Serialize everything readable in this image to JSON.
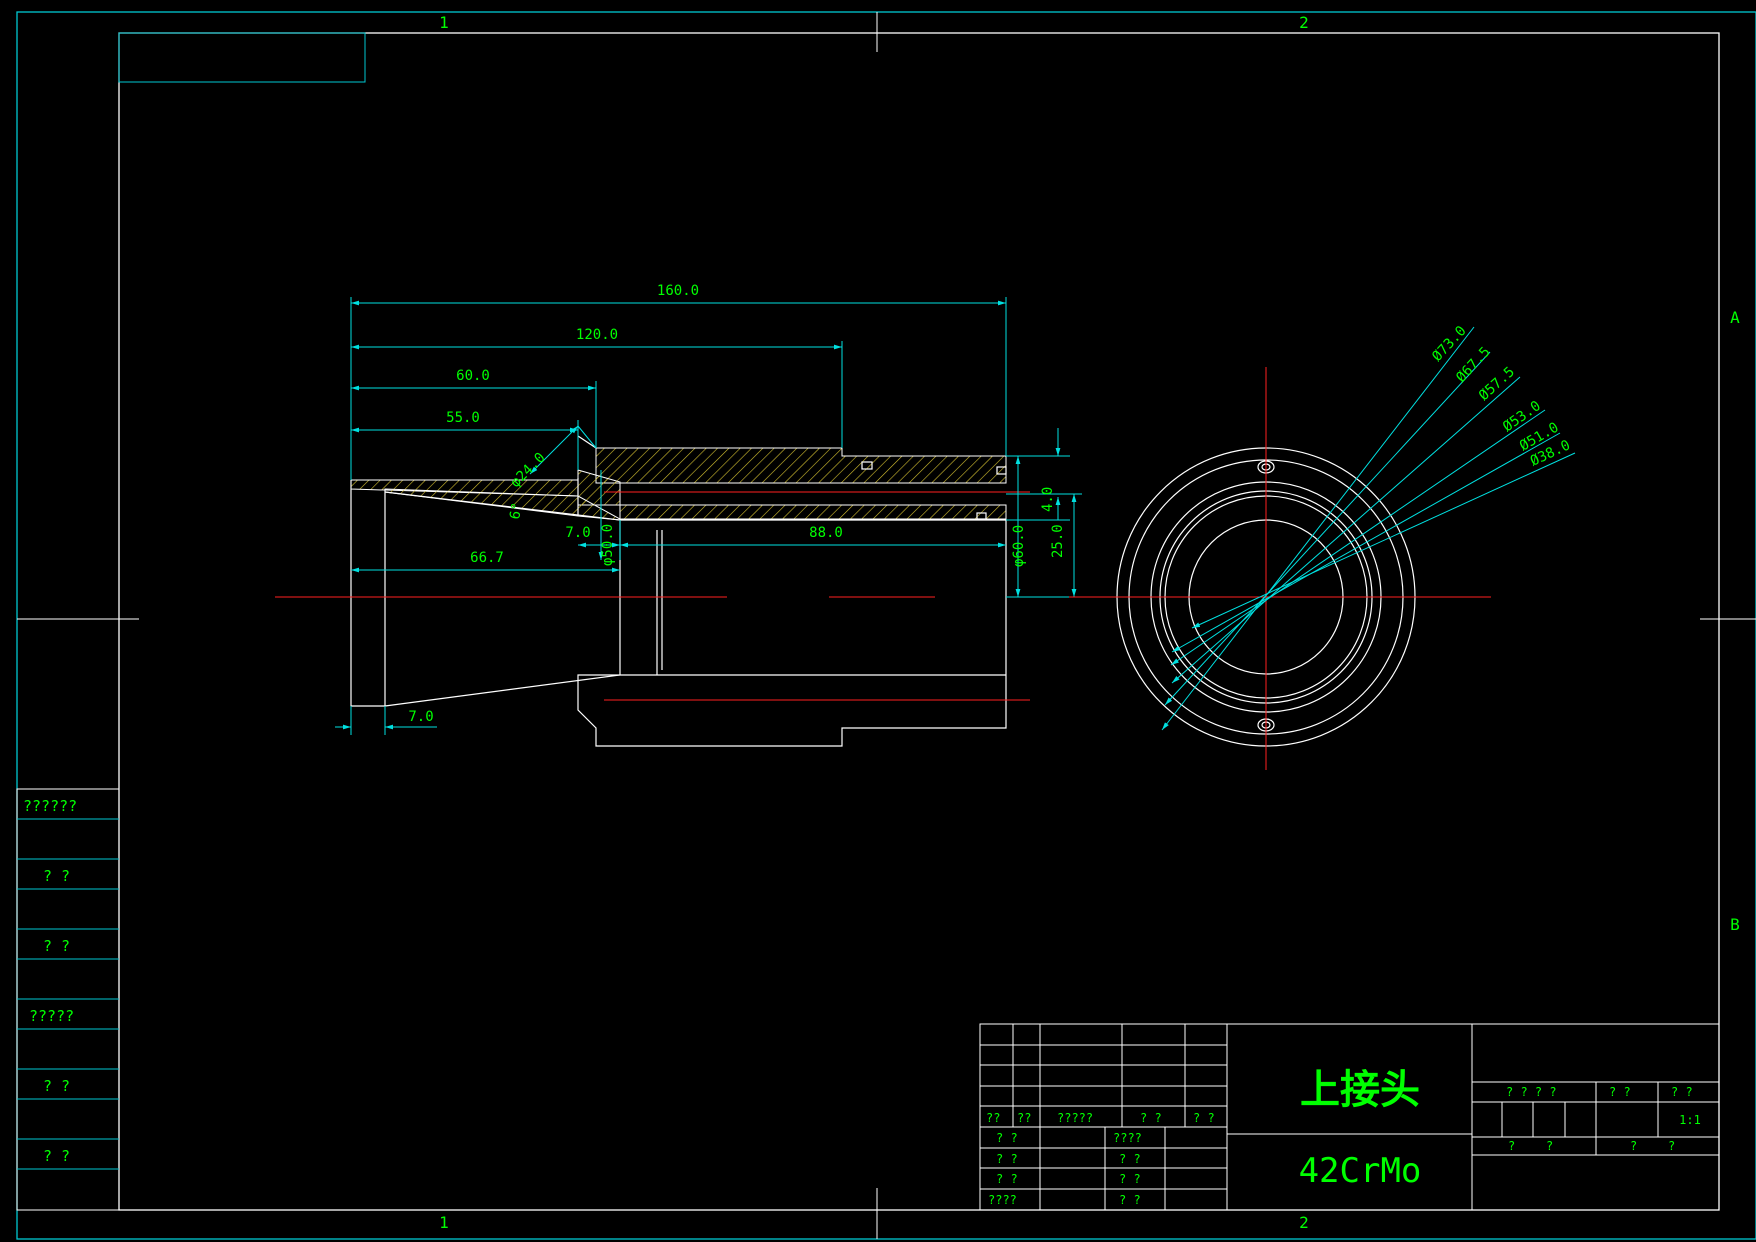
{
  "colors": {
    "background": "#000000",
    "frame": "#00c8d2",
    "outline": "#ffffff",
    "dimension": "#00e0e0",
    "text": "#00ff00",
    "centerline": "#ff2020",
    "hatch": "#d4c030"
  },
  "grid": {
    "col_top_left": "1",
    "col_top_right": "2",
    "col_bottom_left": "1",
    "col_bottom_right": "2",
    "row_a": "A",
    "row_b": "B"
  },
  "section_view": {
    "dims": {
      "total_length": "160.0",
      "length_120": "120.0",
      "length_60": "60.0",
      "length_55": "55.0",
      "chamfer_dia": "φ24.0",
      "angle": "6°",
      "step_7": "7.0",
      "bore_length": "88.0",
      "taper_length": "66.7",
      "bore_dia": "φ50.0",
      "outer_dia_60": "φ60.0",
      "offset_4": "4.0",
      "height_25": "25.0",
      "lip_7": "7.0"
    }
  },
  "end_view": {
    "dims": [
      "Ø73.0",
      "Ø67.5",
      "Ø57.5",
      "Ø53.0",
      "Ø51.0",
      "Ø38.0"
    ]
  },
  "side_table": [
    "??????",
    "?  ?",
    "?  ?",
    "?????",
    "?  ?",
    "?  ?"
  ],
  "title_block": {
    "part_name": "上接头",
    "material": "42CrMo",
    "scale": "1:1",
    "cells": {
      "rev_1": "??",
      "rev_2": "??",
      "rev_3": "?????",
      "rev_4": "?  ?",
      "rev_5": "? ?",
      "sig_1": "?  ?",
      "sig_2": "?  ?",
      "sig_3": "?  ?",
      "sig_4": "????",
      "date_1": "????",
      "date_2": "?  ?",
      "date_3": "?  ?",
      "date_4": "?  ?",
      "hdr_stage": "? ? ? ?",
      "hdr_weight": "?  ?",
      "hdr_scale": "?  ?",
      "sheet_1": "?",
      "sheet_2": "?",
      "sheet_3": "?",
      "sheet_4": "?"
    }
  }
}
